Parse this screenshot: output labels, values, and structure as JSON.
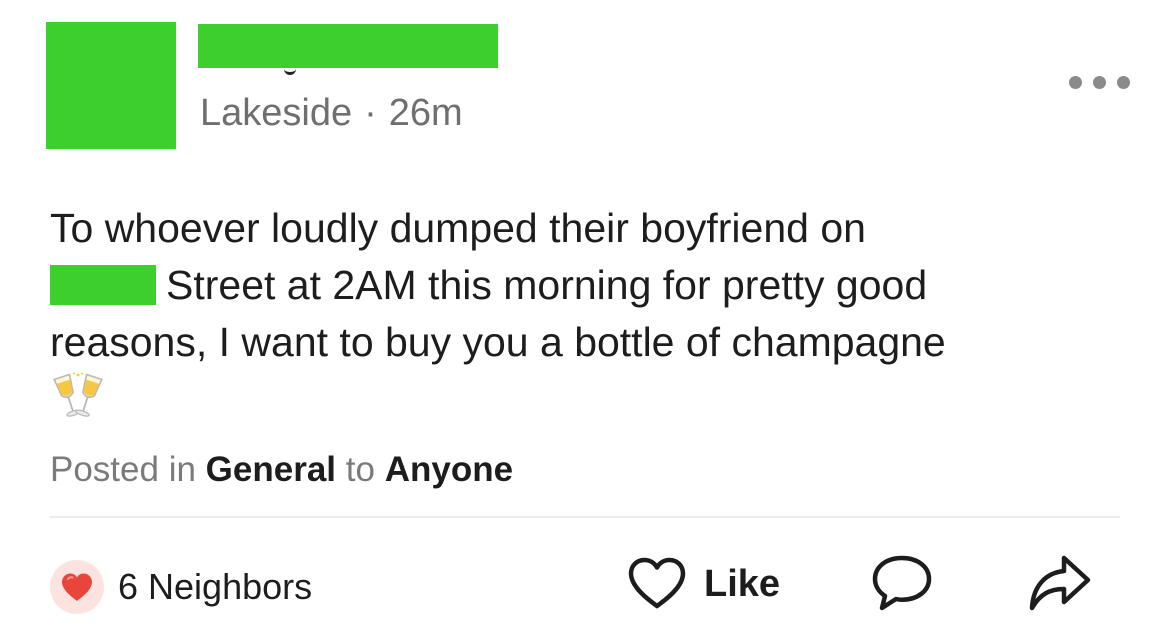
{
  "post": {
    "author": {
      "avatar": "redacted",
      "name": "redacted"
    },
    "location": "Lakeside",
    "separator": "·",
    "time_ago": "26m",
    "more_icon": "more-horizontal-icon",
    "body": {
      "line1": "To whoever loudly dumped their boyfriend on",
      "line2": "Street at 2AM this morning for pretty good",
      "line3": "reasons, I want to buy you a bottle of champagne",
      "emoji": "clinking-glasses-icon"
    },
    "posted_in": {
      "prefix": "Posted in",
      "category": "General",
      "joiner": "to",
      "audience": "Anyone"
    }
  },
  "actions": {
    "reaction_icon": "heart-icon",
    "reaction_count": "6 Neighbors",
    "like_label": "Like",
    "comment_icon": "comment-icon",
    "share_icon": "share-icon"
  },
  "colors": {
    "redaction": "#3dcf2d",
    "reaction_heart": "#e8463a",
    "muted_text": "#6f6f6f"
  }
}
